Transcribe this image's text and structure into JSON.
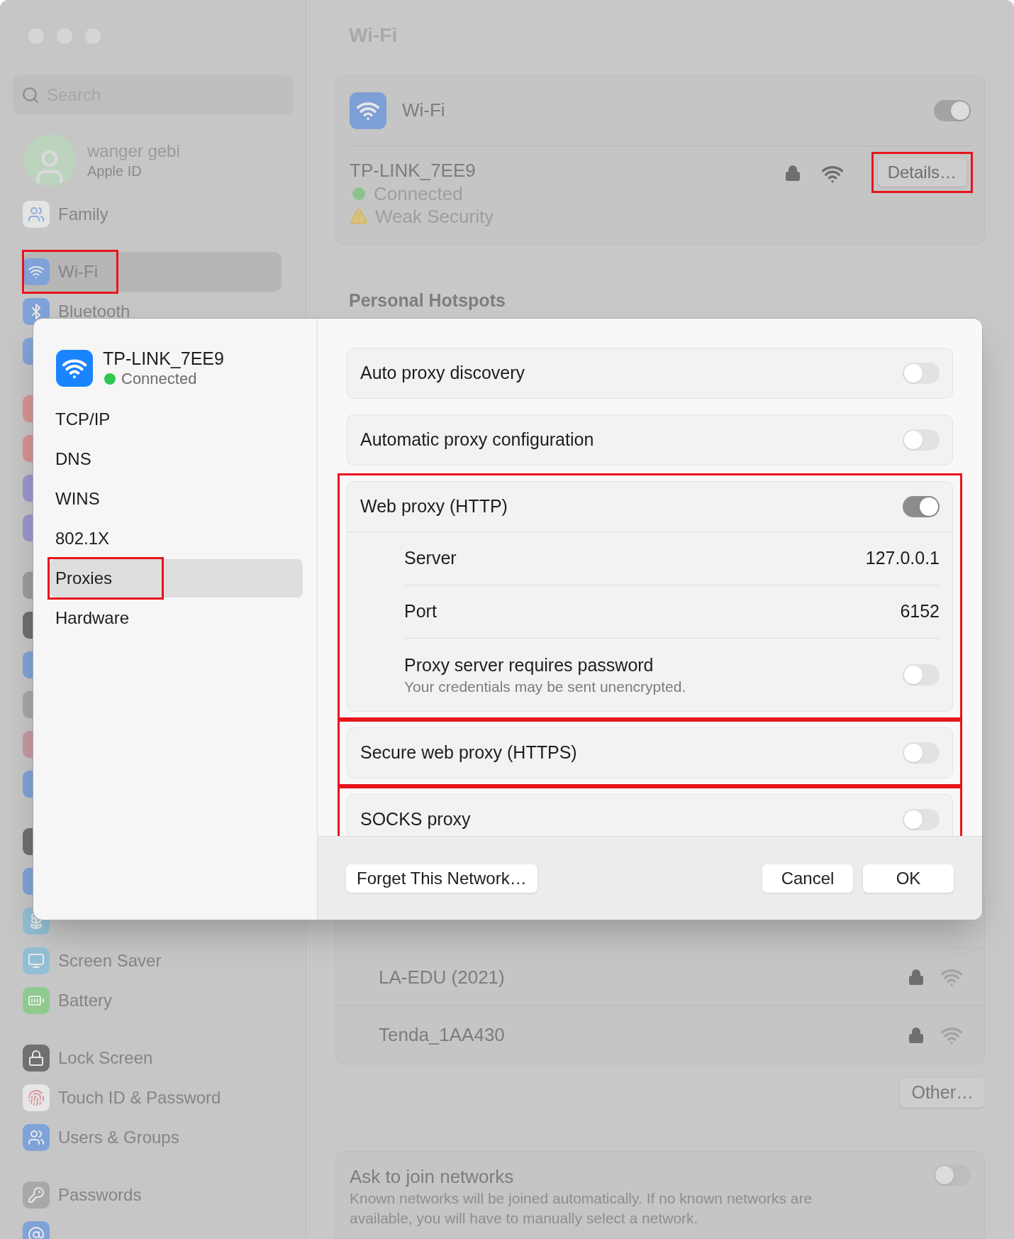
{
  "sidebar": {
    "search": {
      "placeholder": "Search"
    },
    "account": {
      "name": "wanger gebi",
      "subtitle": "Apple ID"
    },
    "groups": [
      {
        "items": [
          {
            "kind": "family",
            "label": "Family",
            "color": "#e4e4e4",
            "selected": false,
            "marked": false
          }
        ]
      },
      {
        "items": [
          {
            "kind": "wifi",
            "label": "Wi-Fi",
            "color": "#7fa3d8",
            "selected": true,
            "marked": true
          },
          {
            "kind": "bluetooth",
            "label": "Bluetooth",
            "color": "#7fa3d8",
            "selected": false,
            "marked": false
          },
          {
            "kind": "tile",
            "color": "#7fa3d8",
            "selected": false,
            "marked": false
          }
        ]
      },
      {
        "items": [
          {
            "kind": "tile",
            "color": "#d89494",
            "selected": false,
            "marked": false
          },
          {
            "kind": "tile",
            "color": "#d89494",
            "selected": false,
            "marked": false
          },
          {
            "kind": "tile",
            "color": "#9c98d0",
            "selected": false,
            "marked": false
          },
          {
            "kind": "tile",
            "color": "#9c98d0",
            "selected": false,
            "marked": false
          }
        ]
      },
      {
        "items": [
          {
            "kind": "tile",
            "color": "#9c9c9c",
            "selected": false,
            "marked": false
          },
          {
            "kind": "tile",
            "color": "#6f6f6f",
            "selected": false,
            "marked": false
          },
          {
            "kind": "tile",
            "color": "#7fa3d8",
            "selected": false,
            "marked": false
          },
          {
            "kind": "tile",
            "color": "#a8a8a8",
            "selected": false,
            "marked": false
          },
          {
            "kind": "tile",
            "color": "#c79aa2",
            "selected": false,
            "marked": false
          },
          {
            "kind": "tile",
            "color": "#7fa3d8",
            "selected": false,
            "marked": false
          }
        ]
      },
      {
        "items": [
          {
            "kind": "tile",
            "color": "#707070",
            "selected": false,
            "marked": false
          },
          {
            "kind": "tile",
            "color": "#7fa3d8",
            "selected": false,
            "marked": false
          },
          {
            "kind": "wallpaper",
            "color": "#93bfd6",
            "selected": false,
            "marked": false
          },
          {
            "kind": "screensaver",
            "label": "Screen Saver",
            "color": "#93bfd6",
            "selected": false,
            "marked": false
          },
          {
            "kind": "battery",
            "label": "Battery",
            "color": "#8fcb8f",
            "selected": false,
            "marked": false
          }
        ]
      },
      {
        "items": [
          {
            "kind": "lock",
            "label": "Lock Screen",
            "color": "#707070",
            "selected": false,
            "marked": false
          },
          {
            "kind": "fingerprint",
            "label": "Touch ID & Password",
            "color": "#e6e6e6",
            "selected": false,
            "marked": false
          },
          {
            "kind": "users",
            "label": "Users & Groups",
            "color": "#7fa3d8",
            "selected": false,
            "marked": false
          }
        ]
      },
      {
        "items": [
          {
            "kind": "key",
            "label": "Passwords",
            "color": "#a8a8a8",
            "selected": false,
            "marked": false
          },
          {
            "kind": "at",
            "color": "#7fa3d8",
            "selected": false,
            "marked": false
          }
        ]
      }
    ]
  },
  "main": {
    "title": "Wi-Fi",
    "wifi_card": {
      "label": "Wi-Fi",
      "on": true,
      "network": {
        "name": "TP-LINK_7EE9",
        "status": "Connected",
        "warning": "Weak Security"
      },
      "details_button": {
        "label": "Details…",
        "marked": true
      }
    },
    "hotspots_heading": "Personal Hotspots",
    "networks": [
      {
        "name": "LA-EDU (2021)"
      },
      {
        "name": "Tenda_1AA430"
      }
    ],
    "other_button": "Other…",
    "ask_join": {
      "label": "Ask to join networks",
      "description": "Known networks will be joined automatically. If no known networks are available, you will have to manually select a network.",
      "on": false
    }
  },
  "dialog": {
    "network": {
      "name": "TP-LINK_7EE9",
      "status": "Connected"
    },
    "nav": [
      {
        "label": "TCP/IP",
        "selected": false,
        "marked": false
      },
      {
        "label": "DNS",
        "selected": false,
        "marked": false
      },
      {
        "label": "WINS",
        "selected": false,
        "marked": false
      },
      {
        "label": "802.1X",
        "selected": false,
        "marked": false
      },
      {
        "label": "Proxies",
        "selected": true,
        "marked": true
      },
      {
        "label": "Hardware",
        "selected": false,
        "marked": false
      }
    ],
    "proxies": [
      {
        "kind": "toggle",
        "label": "Auto proxy discovery",
        "on": false,
        "marked": false
      },
      {
        "kind": "toggle",
        "label": "Automatic proxy configuration",
        "on": false,
        "marked": false
      },
      {
        "kind": "group",
        "label": "Web proxy (HTTP)",
        "on": true,
        "marked": true,
        "server": {
          "label": "Server",
          "value": "127.0.0.1"
        },
        "port": {
          "label": "Port",
          "value": "6152"
        },
        "password": {
          "label": "Proxy server requires password",
          "note": "Your credentials may be sent unencrypted.",
          "on": false
        }
      },
      {
        "kind": "toggle",
        "label": "Secure web proxy (HTTPS)",
        "on": false,
        "marked": true
      },
      {
        "kind": "toggle",
        "label": "SOCKS proxy",
        "on": false,
        "marked": true
      }
    ],
    "buttons": {
      "forget": "Forget This Network…",
      "cancel": "Cancel",
      "ok": "OK"
    }
  }
}
